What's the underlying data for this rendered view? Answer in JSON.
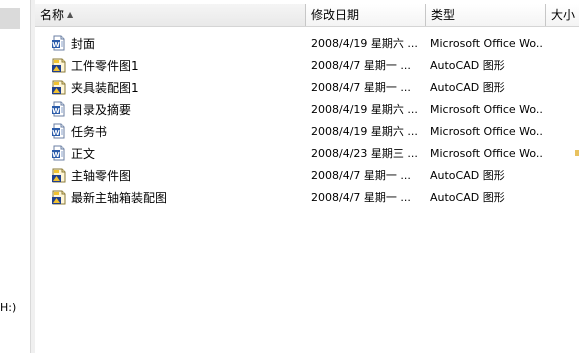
{
  "nav": {
    "partial_text": "H:)"
  },
  "columns": {
    "name": "名称",
    "date": "修改日期",
    "type": "类型",
    "size": "大小"
  },
  "files": [
    {
      "name": "封面",
      "date": "2008/4/19 星期六 ...",
      "type": "Microsoft Office Wo...",
      "icon": "word-doc-icon"
    },
    {
      "name": "工件零件图1",
      "date": "2008/4/7 星期一 ...",
      "type": "AutoCAD 图形",
      "icon": "autocad-dwg-icon"
    },
    {
      "name": "夹具装配图1",
      "date": "2008/4/7 星期一 ...",
      "type": "AutoCAD 图形",
      "icon": "autocad-dwg-icon"
    },
    {
      "name": "目录及摘要",
      "date": "2008/4/19 星期六 ...",
      "type": "Microsoft Office Wo...",
      "icon": "word-doc-icon"
    },
    {
      "name": "任务书",
      "date": "2008/4/19 星期六 ...",
      "type": "Microsoft Office Wo...",
      "icon": "word-doc-icon"
    },
    {
      "name": "正文",
      "date": "2008/4/23 星期三 ...",
      "type": "Microsoft Office Wo...",
      "icon": "word-doc-icon"
    },
    {
      "name": "主轴零件图",
      "date": "2008/4/7 星期一 ...",
      "type": "AutoCAD 图形",
      "icon": "autocad-dwg-icon"
    },
    {
      "name": "最新主轴箱装配图",
      "date": "2008/4/7 星期一 ...",
      "type": "AutoCAD 图形",
      "icon": "autocad-dwg-icon"
    }
  ]
}
